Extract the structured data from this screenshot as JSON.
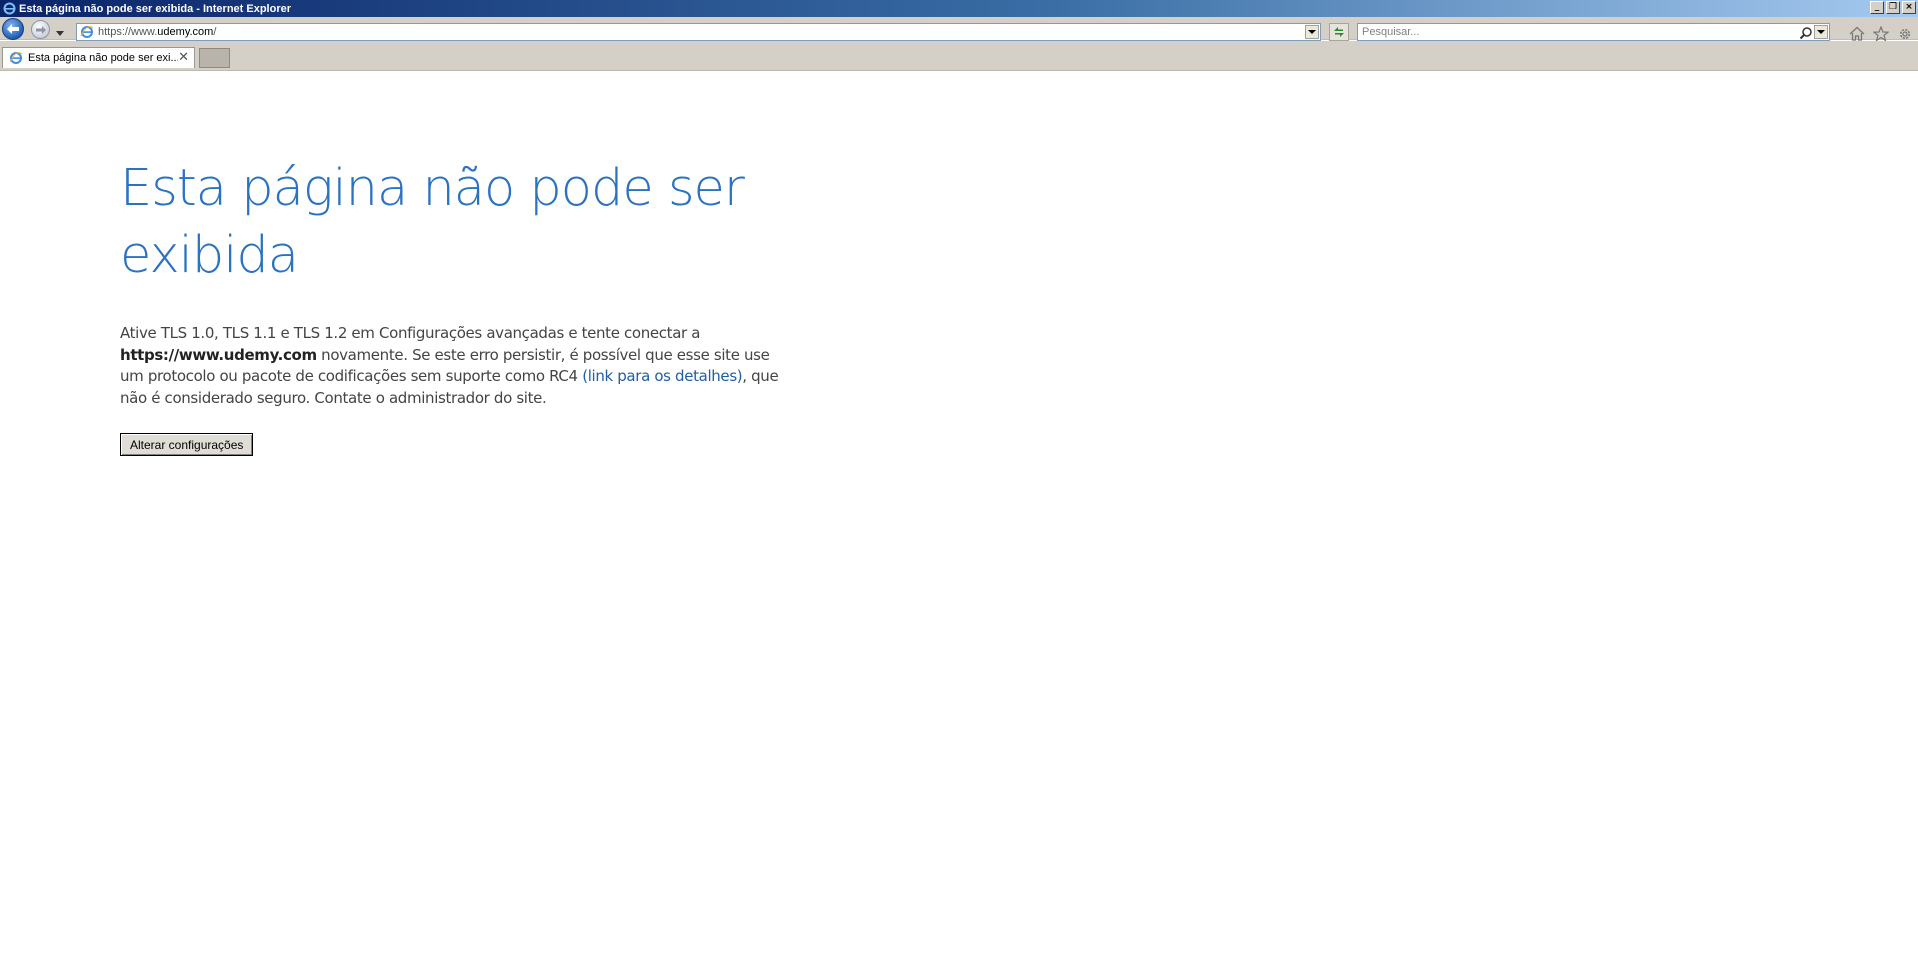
{
  "window": {
    "title": "Esta página não pode ser exibida - Internet Explorer",
    "controls": [
      "minimize",
      "restore",
      "close"
    ]
  },
  "navbar": {
    "address_prefix": "https://www.",
    "address_domain": "udemy.com",
    "address_suffix": "/",
    "search_placeholder": "Pesquisar..."
  },
  "tabs": [
    {
      "label": "Esta página não pode ser exi...",
      "active": true
    }
  ],
  "content": {
    "title": "Esta página não pode ser exibida",
    "body_part1": "Ative TLS 1.0, TLS 1.1 e TLS 1.2 em Configurações avançadas e tente conectar a ",
    "body_url": "https://www.udemy.com",
    "body_part2": " novamente. Se este erro persistir, é possível que esse site use um protocolo ou pacote de codificações sem suporte como RC4 ",
    "body_link": "(link para os detalhes)",
    "body_part3": ", que não é considerado seguro. Contate o administrador do site.",
    "button_label": "Alterar configurações"
  },
  "icons": {
    "title": "ie-logo-icon",
    "back": "back-arrow-icon",
    "forward": "forward-arrow-icon",
    "refresh": "refresh-icon",
    "search": "magnifier-icon",
    "home": "home-icon",
    "favorites": "star-icon",
    "tools": "gear-icon"
  },
  "colors": {
    "title_blue": "#2a72c2",
    "link": "#1e5fa8",
    "chrome": "#d4d0c8"
  }
}
